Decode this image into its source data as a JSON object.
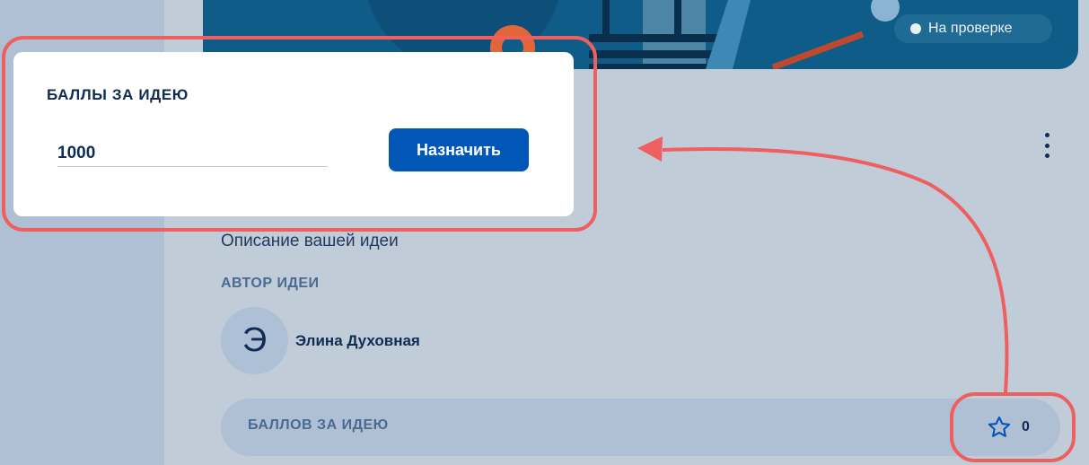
{
  "status_badge": {
    "label": "На проверке"
  },
  "score_modal": {
    "title": "БАЛЛЫ ЗА ИДЕЮ",
    "input_value": "1000",
    "assign_label": "Назначить"
  },
  "idea": {
    "description": "Описание вашей идеи",
    "author_label": "АВТОР ИДЕИ",
    "author_initial": "Э",
    "author_name": "Элина Духовная",
    "points_label": "БАЛЛОВ ЗА ИДЕЮ",
    "points_value": "0"
  },
  "icons": {
    "menu": "more-vertical-icon",
    "star": "star-icon",
    "status_dot": "status-dot-icon"
  },
  "colors": {
    "accent": "#0057b8",
    "highlight": "#ef5f5f",
    "banner": "#0f5c88",
    "background": "#c1ccd9"
  }
}
